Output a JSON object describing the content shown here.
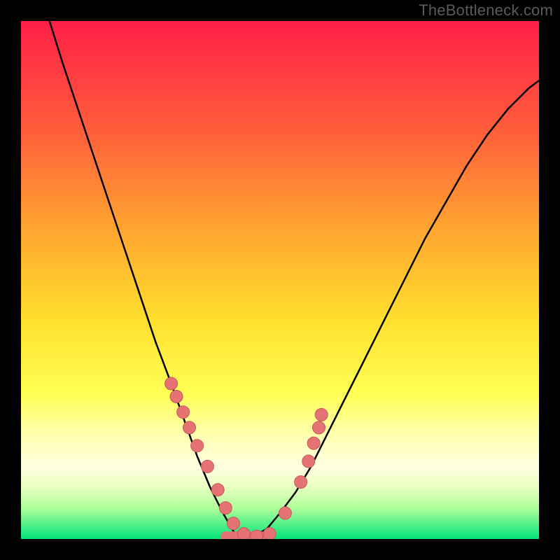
{
  "watermark": "TheBottleneck.com",
  "colors": {
    "bg_black": "#000000",
    "gradient_stops": [
      {
        "offset": 0.0,
        "color": "#ff1f47"
      },
      {
        "offset": 0.2,
        "color": "#ff5a3b"
      },
      {
        "offset": 0.4,
        "color": "#ffa430"
      },
      {
        "offset": 0.58,
        "color": "#ffe02e"
      },
      {
        "offset": 0.72,
        "color": "#ffff55"
      },
      {
        "offset": 0.8,
        "color": "#ffffb0"
      },
      {
        "offset": 0.86,
        "color": "#ffffe0"
      },
      {
        "offset": 0.9,
        "color": "#e8ffc0"
      },
      {
        "offset": 0.94,
        "color": "#b0ff9a"
      },
      {
        "offset": 1.0,
        "color": "#00e47a"
      }
    ],
    "curve": "#000000",
    "dots_fill": "#e57373",
    "dots_stroke": "#c75a5a"
  },
  "chart_data": {
    "type": "line",
    "title": "",
    "xlabel": "",
    "ylabel": "",
    "xlim": [
      0,
      1
    ],
    "ylim": [
      0,
      1
    ],
    "notes": "V-shaped bottleneck curve on a red-to-green vertical gradient. y-axis implied: higher = worse (red), lower = better (green). Curve minimum (best match) near x≈0.42, y≈0.",
    "series": [
      {
        "name": "bottleneck_curve",
        "x": [
          0.055,
          0.08,
          0.11,
          0.14,
          0.17,
          0.2,
          0.23,
          0.26,
          0.29,
          0.315,
          0.34,
          0.365,
          0.39,
          0.41,
          0.425,
          0.45,
          0.475,
          0.5,
          0.53,
          0.56,
          0.59,
          0.62,
          0.66,
          0.7,
          0.74,
          0.78,
          0.82,
          0.86,
          0.9,
          0.94,
          0.98,
          1.0
        ],
        "y": [
          1.0,
          0.92,
          0.83,
          0.74,
          0.65,
          0.56,
          0.47,
          0.38,
          0.3,
          0.23,
          0.16,
          0.1,
          0.05,
          0.015,
          0.0,
          0.005,
          0.02,
          0.05,
          0.09,
          0.14,
          0.2,
          0.26,
          0.34,
          0.42,
          0.5,
          0.58,
          0.65,
          0.72,
          0.78,
          0.83,
          0.87,
          0.885
        ]
      },
      {
        "name": "highlight_dots",
        "x": [
          0.29,
          0.3,
          0.313,
          0.325,
          0.34,
          0.36,
          0.38,
          0.395,
          0.41,
          0.43,
          0.455,
          0.48,
          0.51,
          0.54,
          0.555,
          0.565,
          0.575,
          0.58
        ],
        "y": [
          0.3,
          0.275,
          0.245,
          0.215,
          0.18,
          0.14,
          0.095,
          0.06,
          0.03,
          0.01,
          0.005,
          0.01,
          0.05,
          0.11,
          0.15,
          0.185,
          0.215,
          0.24
        ]
      }
    ],
    "flat_bottom_bar": {
      "x0": 0.395,
      "x1": 0.48,
      "y": 0.005
    }
  }
}
